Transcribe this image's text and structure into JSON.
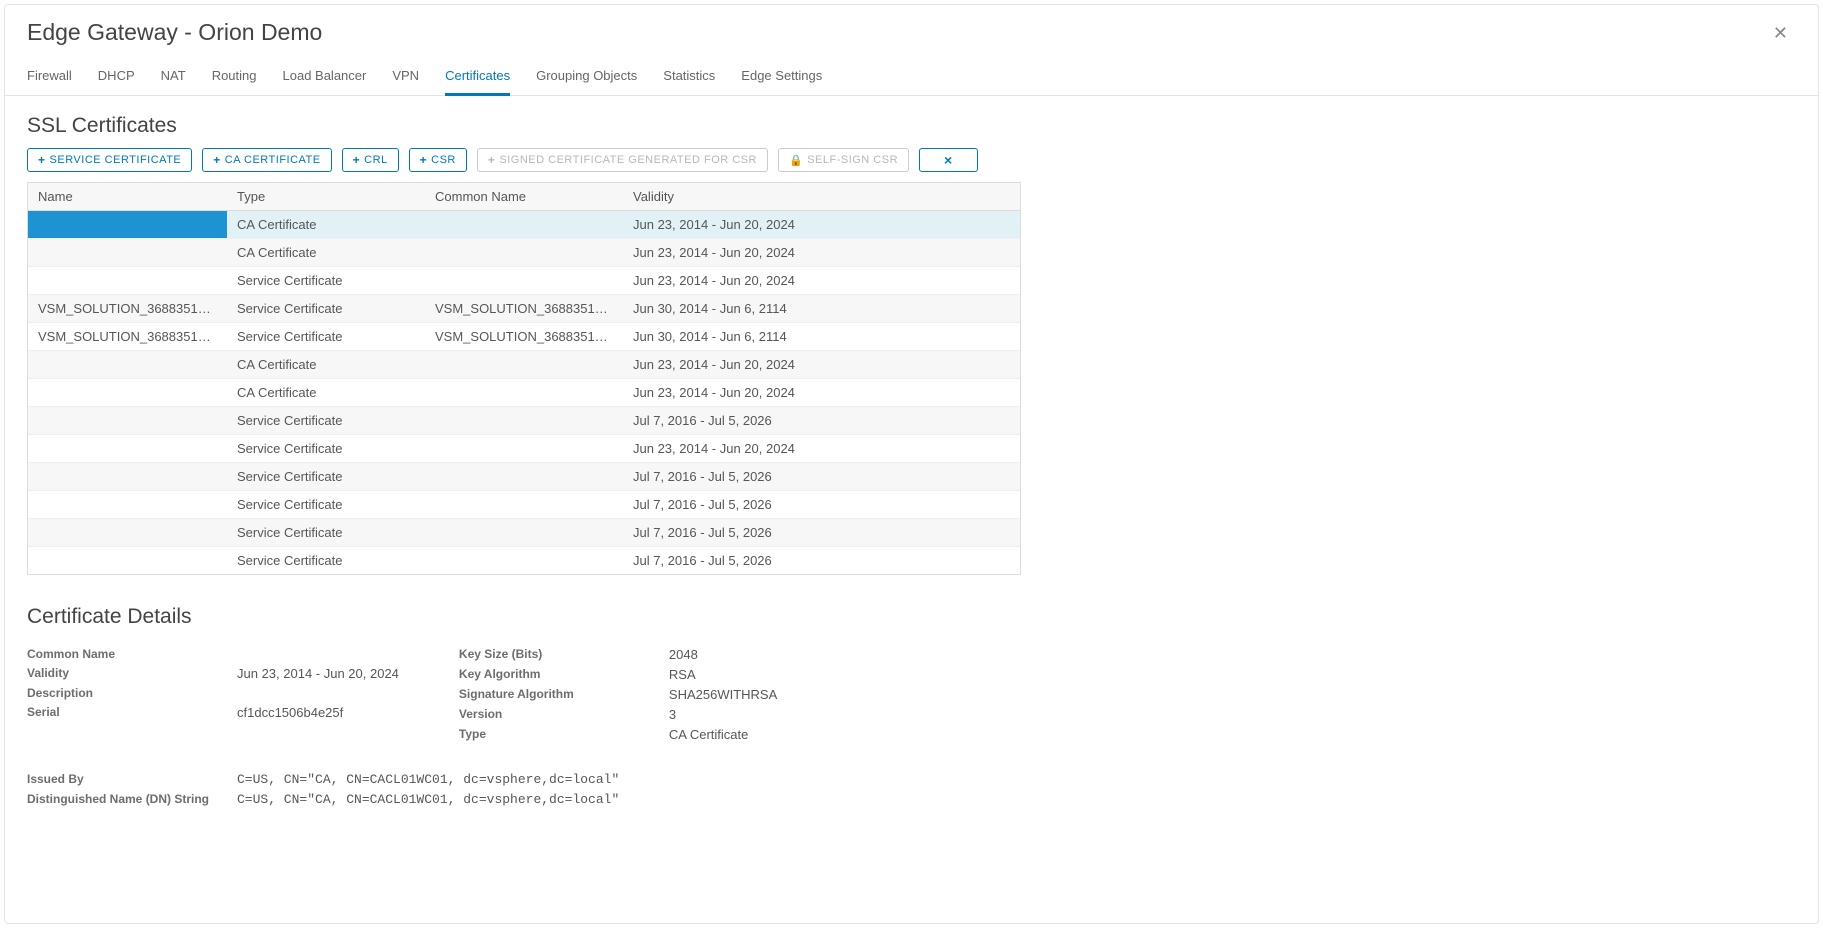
{
  "header": {
    "title": "Edge Gateway - Orion Demo"
  },
  "tabs": [
    {
      "label": "Firewall"
    },
    {
      "label": "DHCP"
    },
    {
      "label": "NAT"
    },
    {
      "label": "Routing"
    },
    {
      "label": "Load Balancer"
    },
    {
      "label": "VPN"
    },
    {
      "label": "Certificates",
      "active": true
    },
    {
      "label": "Grouping Objects"
    },
    {
      "label": "Statistics"
    },
    {
      "label": "Edge Settings"
    }
  ],
  "section": {
    "ssl_title": "SSL Certificates",
    "details_title": "Certificate Details"
  },
  "buttons": {
    "service_cert": "SERVICE CERTIFICATE",
    "ca_cert": "CA CERTIFICATE",
    "crl": "CRL",
    "csr": "CSR",
    "signed_for_csr": "SIGNED CERTIFICATE GENERATED FOR CSR",
    "self_sign_csr": "SELF-SIGN CSR"
  },
  "table": {
    "columns": {
      "name": "Name",
      "type": "Type",
      "common_name": "Common Name",
      "validity": "Validity"
    },
    "rows": [
      {
        "name": "",
        "type": "CA Certificate",
        "common_name": "",
        "validity": "Jun 23, 2014 - Jun 20, 2024",
        "selected": true
      },
      {
        "name": "",
        "type": "CA Certificate",
        "common_name": "",
        "validity": "Jun 23, 2014 - Jun 20, 2024"
      },
      {
        "name": "",
        "type": "Service Certificate",
        "common_name": "",
        "validity": "Jun 23, 2014 - Jun 20, 2024"
      },
      {
        "name": "VSM_SOLUTION_36883519-a24c...",
        "type": "Service Certificate",
        "common_name": "VSM_SOLUTION_36883519-a24c...",
        "validity": "Jun 30, 2014 - Jun 6, 2114"
      },
      {
        "name": "VSM_SOLUTION_36883519-a24c...",
        "type": "Service Certificate",
        "common_name": "VSM_SOLUTION_36883519-a24c...",
        "validity": "Jun 30, 2014 - Jun 6, 2114"
      },
      {
        "name": "",
        "type": "CA Certificate",
        "common_name": "",
        "validity": "Jun 23, 2014 - Jun 20, 2024"
      },
      {
        "name": "",
        "type": "CA Certificate",
        "common_name": "",
        "validity": "Jun 23, 2014 - Jun 20, 2024"
      },
      {
        "name": "",
        "type": "Service Certificate",
        "common_name": "",
        "validity": "Jul 7, 2016 - Jul 5, 2026"
      },
      {
        "name": "",
        "type": "Service Certificate",
        "common_name": "",
        "validity": "Jun 23, 2014 - Jun 20, 2024"
      },
      {
        "name": "",
        "type": "Service Certificate",
        "common_name": "",
        "validity": "Jul 7, 2016 - Jul 5, 2026"
      },
      {
        "name": "",
        "type": "Service Certificate",
        "common_name": "",
        "validity": "Jul 7, 2016 - Jul 5, 2026"
      },
      {
        "name": "",
        "type": "Service Certificate",
        "common_name": "",
        "validity": "Jul 7, 2016 - Jul 5, 2026"
      },
      {
        "name": "",
        "type": "Service Certificate",
        "common_name": "",
        "validity": "Jul 7, 2016 - Jul 5, 2026"
      }
    ]
  },
  "details": {
    "left": {
      "common_name_label": "Common Name",
      "common_name_value": "",
      "validity_label": "Validity",
      "validity_value": "Jun 23, 2014 - Jun 20, 2024",
      "description_label": "Description",
      "description_value": "",
      "serial_label": "Serial",
      "serial_value": "cf1dcc1506b4e25f"
    },
    "right": {
      "key_size_label": "Key Size (Bits)",
      "key_size_value": "2048",
      "key_algo_label": "Key Algorithm",
      "key_algo_value": "RSA",
      "sig_algo_label": "Signature Algorithm",
      "sig_algo_value": "SHA256WITHRSA",
      "version_label": "Version",
      "version_value": "3",
      "type_label": "Type",
      "type_value": "CA Certificate"
    },
    "bottom": {
      "issued_by_label": "Issued By",
      "issued_by_value": "C=US, CN=\"CA, CN=CACL01WC01, dc=vsphere,dc=local\"",
      "dn_label": "Distinguished Name (DN) String",
      "dn_value": "C=US, CN=\"CA, CN=CACL01WC01, dc=vsphere,dc=local\""
    }
  }
}
